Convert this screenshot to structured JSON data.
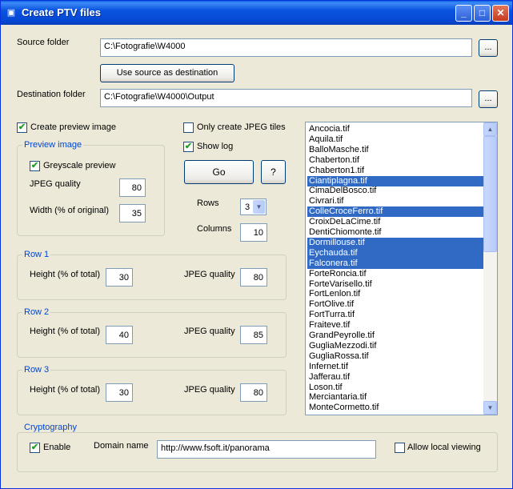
{
  "window": {
    "title": "Create PTV files",
    "icon": "document-icon"
  },
  "titlebar_buttons": {
    "minimize": "_",
    "maximize": "□",
    "close": "✕"
  },
  "source": {
    "label": "Source folder",
    "value": "C:\\Fotografie\\W4000",
    "browse": "...",
    "use_source_button": "Use source as destination"
  },
  "destination": {
    "label": "Destination folder",
    "value": "C:\\Fotografie\\W4000\\Output",
    "browse": "..."
  },
  "preview": {
    "create_label": "Create preview image",
    "create_checked": true,
    "group_title": "Preview image",
    "greyscale_label": "Greyscale preview",
    "greyscale_checked": true,
    "jpeg_quality_label": "JPEG quality",
    "jpeg_quality": "80",
    "width_label": "Width (% of original)",
    "width": "35"
  },
  "options": {
    "only_jpeg_label": "Only create JPEG tiles",
    "only_jpeg_checked": false,
    "show_log_label": "Show log",
    "show_log_checked": true,
    "go_button": "Go",
    "help_button": "?",
    "rows_label": "Rows",
    "rows_value": "3",
    "columns_label": "Columns",
    "columns_value": "10"
  },
  "rows": [
    {
      "title": "Row 1",
      "height_label": "Height (% of total)",
      "height": "30",
      "quality_label": "JPEG quality",
      "quality": "80"
    },
    {
      "title": "Row 2",
      "height_label": "Height (% of total)",
      "height": "40",
      "quality_label": "JPEG quality",
      "quality": "85"
    },
    {
      "title": "Row 3",
      "height_label": "Height (% of total)",
      "height": "30",
      "quality_label": "JPEG quality",
      "quality": "80"
    }
  ],
  "crypto": {
    "title": "Cryptography",
    "enable_label": "Enable",
    "enable_checked": true,
    "domain_label": "Domain name",
    "domain_value": "http://www.fsoft.it/panorama",
    "local_label": "Allow local viewing",
    "local_checked": false
  },
  "files": [
    {
      "name": "Ancocia.tif",
      "selected": false
    },
    {
      "name": "Aquila.tif",
      "selected": false
    },
    {
      "name": "BalloMasche.tif",
      "selected": false
    },
    {
      "name": "Chaberton.tif",
      "selected": false
    },
    {
      "name": "Chaberton1.tif",
      "selected": false
    },
    {
      "name": "Ciantiplagna.tif",
      "selected": true
    },
    {
      "name": "CimaDelBosco.tif",
      "selected": false
    },
    {
      "name": "Civrari.tif",
      "selected": false
    },
    {
      "name": "ColleCroceFerro.tif",
      "selected": true
    },
    {
      "name": "CroixDeLaCime.tif",
      "selected": false
    },
    {
      "name": "DentiChiomonte.tif",
      "selected": false
    },
    {
      "name": "Dormillouse.tif",
      "selected": true
    },
    {
      "name": "Eychauda.tif",
      "selected": true
    },
    {
      "name": "Falconera.tif",
      "selected": true
    },
    {
      "name": "ForteRoncia.tif",
      "selected": false
    },
    {
      "name": "ForteVarisello.tif",
      "selected": false
    },
    {
      "name": "FortLenlon.tif",
      "selected": false
    },
    {
      "name": "FortOlive.tif",
      "selected": false
    },
    {
      "name": "FortTurra.tif",
      "selected": false
    },
    {
      "name": "Fraiteve.tif",
      "selected": false
    },
    {
      "name": "GrandPeyrolle.tif",
      "selected": false
    },
    {
      "name": "GugliaMezzodi.tif",
      "selected": false
    },
    {
      "name": "GugliaRossa.tif",
      "selected": false
    },
    {
      "name": "Infernet.tif",
      "selected": false
    },
    {
      "name": "Jafferau.tif",
      "selected": false
    },
    {
      "name": "Loson.tif",
      "selected": false
    },
    {
      "name": "Merciantaria.tif",
      "selected": false
    },
    {
      "name": "MonteCormetto.tif",
      "selected": false
    }
  ],
  "colors": {
    "selection": "#316ac5",
    "group_title": "#0046d5",
    "titlebar": "#0a54e0"
  }
}
